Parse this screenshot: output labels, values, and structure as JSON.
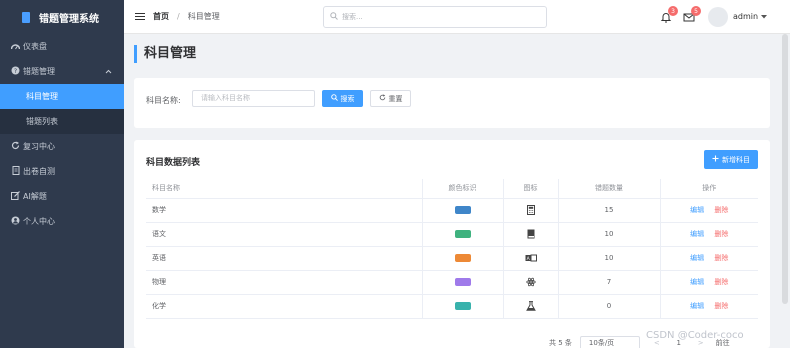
{
  "app": {
    "title": "错题管理系统"
  },
  "sidebar": {
    "items": [
      {
        "label": "仪表盘",
        "icon": "dashboard-icon"
      },
      {
        "label": "错题管理",
        "icon": "question-icon",
        "expanded": true,
        "children": [
          {
            "label": "科目管理",
            "active": true
          },
          {
            "label": "错题列表",
            "active": false
          }
        ]
      },
      {
        "label": "复习中心",
        "icon": "refresh-icon"
      },
      {
        "label": "出卷自测",
        "icon": "document-icon"
      },
      {
        "label": "AI解题",
        "icon": "edit-icon"
      },
      {
        "label": "个人中心",
        "icon": "user-icon"
      }
    ]
  },
  "header": {
    "breadcrumb": {
      "home": "首页",
      "separator": "/",
      "current": "科目管理"
    },
    "search_placeholder": "搜索...",
    "notifications": {
      "bell_count": "3",
      "mail_count": "5"
    },
    "user": "admin"
  },
  "page": {
    "title": "科目管理"
  },
  "filter": {
    "label": "科目名称:",
    "placeholder": "请输入科目名称",
    "search_label": "搜索",
    "reset_label": "重置"
  },
  "table": {
    "title": "科目数据列表",
    "add_label": "新增科目",
    "columns": [
      "科目名称",
      "颜色标识",
      "图标",
      "错题数量",
      "操作"
    ],
    "rows": [
      {
        "name": "数学",
        "color": "#3f86c9",
        "icon": "calculator-icon",
        "count": "15"
      },
      {
        "name": "语文",
        "color": "#3fb27f",
        "icon": "book-icon",
        "count": "10"
      },
      {
        "name": "英语",
        "color": "#ed8936",
        "icon": "language-icon",
        "count": "10"
      },
      {
        "name": "物理",
        "color": "#9f7aea",
        "icon": "atom-icon",
        "count": "7"
      },
      {
        "name": "化学",
        "color": "#38b2ac",
        "icon": "flask-icon",
        "count": "0"
      }
    ],
    "edit_label": "编辑",
    "delete_label": "删除"
  },
  "pagination": {
    "total": "共 5 条",
    "page_size": "10条/页",
    "prev": "<",
    "page": "1",
    "next": ">",
    "goto": "前往"
  },
  "watermark": "CSDN @Coder-coco",
  "colors": {
    "accent": "#409eff",
    "danger": "#f56c6c",
    "sidebar_bg": "#2f3a4d"
  }
}
